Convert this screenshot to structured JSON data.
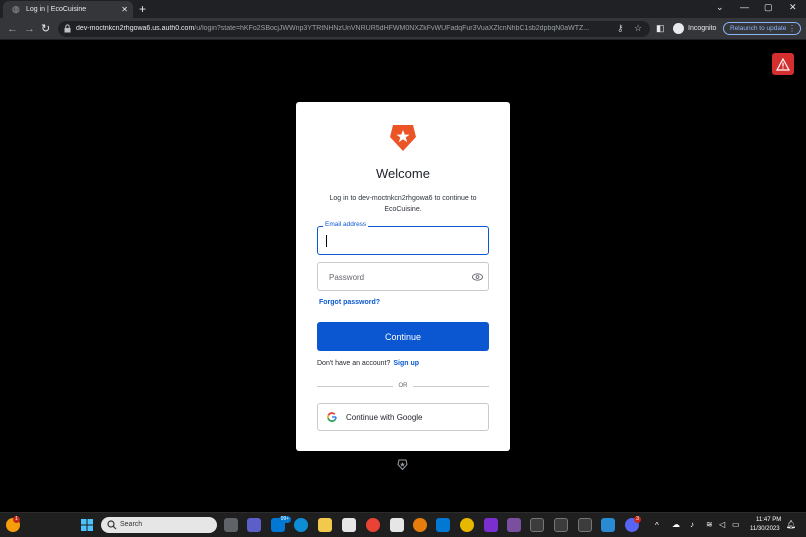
{
  "browser": {
    "tab": {
      "title": "Log in | EcoCuisine",
      "close_glyph": "✕"
    },
    "new_tab_glyph": "+",
    "window_controls": [
      "⌄",
      "—",
      "▢",
      "✕"
    ],
    "url_host": "dev-moctnkcn2rhgowa6.us.auth0.com",
    "url_path": "/u/login?state=hKFo2SBocjJWWnp3YTRtNHNzUnVNRUR5dHFWM0NXZkFvWUFadqFur3VuaXZlcnNhbC1sb2dpbqN0aWTZ...",
    "incognito_label": "Incognito",
    "relaunch_label": "Relaunch to update"
  },
  "login": {
    "heading": "Welcome",
    "intro": "Log in to dev-moctnkcn2rhgowa6 to continue to EcoCuisine.",
    "email_label": "Email address",
    "email_value": "",
    "password_placeholder": "Password",
    "forgot_label": "Forgot password?",
    "continue_label": "Continue",
    "no_account_text": "Don't have an account?",
    "signup_label": "Sign up",
    "or_text": "OR",
    "google_label": "Continue with Google"
  },
  "taskbar": {
    "search_label": "Search",
    "time": "11:47 PM",
    "date": "11/30/2023",
    "weather_badge": "1",
    "mail_badge": "99+",
    "discord_badge": "3"
  },
  "colors": {
    "accent": "#0a57d1",
    "brand": "#eb5424",
    "alert": "#d32f2f",
    "chrome_dark": "#202124",
    "chrome_toolbar": "#35363a"
  }
}
